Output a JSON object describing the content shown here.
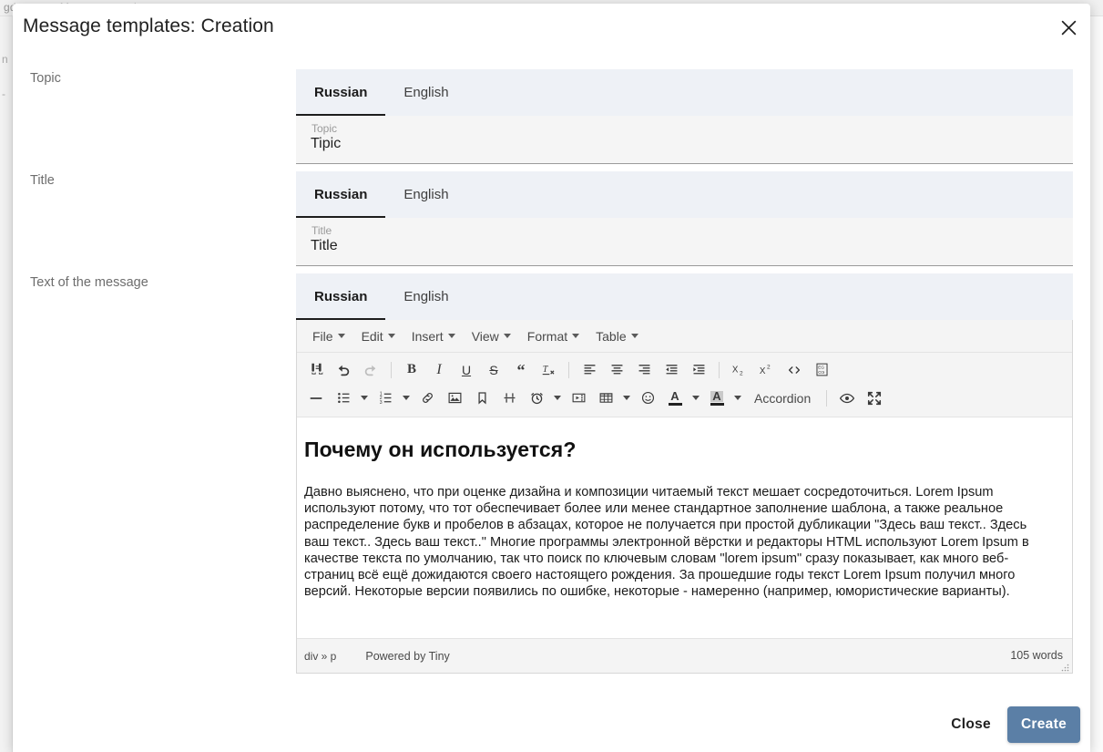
{
  "background": {
    "breadcrumb_tail": "gda",
    "breadcrumb_chevron": "‹",
    "breadcrumb_title": "Message templates",
    "left_edge_glyphs": [
      "n",
      "-"
    ],
    "right_edge_glyph": "›"
  },
  "modal": {
    "title": "Message templates: Creation",
    "close_icon": "close-icon"
  },
  "fields": [
    {
      "label": "Topic",
      "tabs": [
        {
          "label": "Russian",
          "active": true
        },
        {
          "label": "English",
          "active": false
        }
      ],
      "input": {
        "label": "Topic",
        "value": "Tipic",
        "placeholder": "Topic"
      }
    },
    {
      "label": "Title",
      "tabs": [
        {
          "label": "Russian",
          "active": true
        },
        {
          "label": "English",
          "active": false
        }
      ],
      "input": {
        "label": "Title",
        "value": "Title",
        "placeholder": "Title"
      }
    }
  ],
  "message": {
    "label": "Text of the message",
    "tabs": [
      {
        "label": "Russian",
        "active": true
      },
      {
        "label": "English",
        "active": false
      }
    ],
    "editor": {
      "menus": [
        "File",
        "Edit",
        "Insert",
        "View",
        "Format",
        "Table"
      ],
      "toolbar_row1": [
        {
          "name": "searchreplace-icon",
          "label": "Search and replace",
          "disabled": false
        },
        {
          "name": "undo-icon",
          "label": "Undo",
          "disabled": false
        },
        {
          "name": "redo-icon",
          "label": "Redo",
          "disabled": true
        },
        {
          "name": "separator",
          "label": ""
        },
        {
          "name": "bold-icon",
          "label": "Bold",
          "disabled": false
        },
        {
          "name": "italic-icon",
          "label": "Italic",
          "disabled": false
        },
        {
          "name": "underline-icon",
          "label": "Underline",
          "disabled": false
        },
        {
          "name": "strikethrough-icon",
          "label": "Strikethrough",
          "disabled": false
        },
        {
          "name": "blockquote-icon",
          "label": "Blockquote",
          "disabled": false
        },
        {
          "name": "removeformat-icon",
          "label": "Clear formatting",
          "disabled": false
        },
        {
          "name": "separator",
          "label": ""
        },
        {
          "name": "align-left-icon",
          "label": "Align left",
          "disabled": false
        },
        {
          "name": "align-center-icon",
          "label": "Align center",
          "disabled": false
        },
        {
          "name": "align-right-icon",
          "label": "Align right",
          "disabled": false
        },
        {
          "name": "outdent-icon",
          "label": "Decrease indent",
          "disabled": false
        },
        {
          "name": "indent-icon",
          "label": "Increase indent",
          "disabled": false
        },
        {
          "name": "separator",
          "label": ""
        },
        {
          "name": "subscript-icon",
          "label": "Subscript",
          "disabled": false
        },
        {
          "name": "superscript-icon",
          "label": "Superscript",
          "disabled": false
        },
        {
          "name": "sourcecode-icon",
          "label": "Source code",
          "disabled": false
        },
        {
          "name": "charmap-icon",
          "label": "Special character",
          "disabled": false
        }
      ],
      "toolbar_row2": [
        {
          "name": "horizontal-rule-icon",
          "label": "Horizontal line"
        },
        {
          "name": "bullist-icon",
          "label": "Bullet list",
          "caret": true
        },
        {
          "name": "numlist-icon",
          "label": "Numbered list",
          "caret": true
        },
        {
          "name": "link-icon",
          "label": "Insert link"
        },
        {
          "name": "image-icon",
          "label": "Insert image"
        },
        {
          "name": "anchor-icon",
          "label": "Anchor"
        },
        {
          "name": "pagebreak-icon",
          "label": "Page break"
        },
        {
          "name": "insertdatetime-icon",
          "label": "Insert date/time",
          "caret": true
        },
        {
          "name": "media-icon",
          "label": "Insert media"
        },
        {
          "name": "table-icon",
          "label": "Table",
          "caret": true
        },
        {
          "name": "emoticons-icon",
          "label": "Emoticons"
        },
        {
          "name": "forecolor-icon",
          "label": "Text color",
          "caret": true
        },
        {
          "name": "backcolor-icon",
          "label": "Background color",
          "caret": true
        },
        {
          "name": "accordion-button",
          "label": "Accordion"
        },
        {
          "name": "separator",
          "label": ""
        },
        {
          "name": "preview-icon",
          "label": "Preview"
        },
        {
          "name": "fullscreen-icon",
          "label": "Fullscreen"
        }
      ],
      "content": {
        "heading": "Почему он используется?",
        "paragraph": "Давно выяснено, что при оценке дизайна и композиции читаемый текст мешает сосредоточиться. Lorem Ipsum используют потому, что тот обеспечивает более или менее стандартное заполнение шаблона, а также реальное распределение букв и пробелов в абзацах, которое не получается при простой дубликации \"Здесь ваш текст.. Здесь ваш текст.. Здесь ваш текст..\" Многие программы электронной вёрстки и редакторы HTML используют Lorem Ipsum в качестве текста по умолчанию, так что поиск по ключевым словам \"lorem ipsum\" сразу показывает, как много веб-страниц всё ещё дожидаются своего настоящего рождения. За прошедшие годы текст Lorem Ipsum получил много версий. Некоторые версии появились по ошибке, некоторые - намеренно (например, юмористические варианты)."
      },
      "statusbar": {
        "element_path": "div » p",
        "branding": "Powered by Tiny",
        "wordcount": "105 words"
      }
    }
  },
  "footer": {
    "close_label": "Close",
    "create_label": "Create"
  },
  "colors": {
    "primary": "#5b7fa6",
    "tab_bg": "#eef1f6",
    "tab_underline": "#1d1d1d",
    "input_bg": "#f5f5f5",
    "toolbar_bg": "#f4f4f4"
  }
}
